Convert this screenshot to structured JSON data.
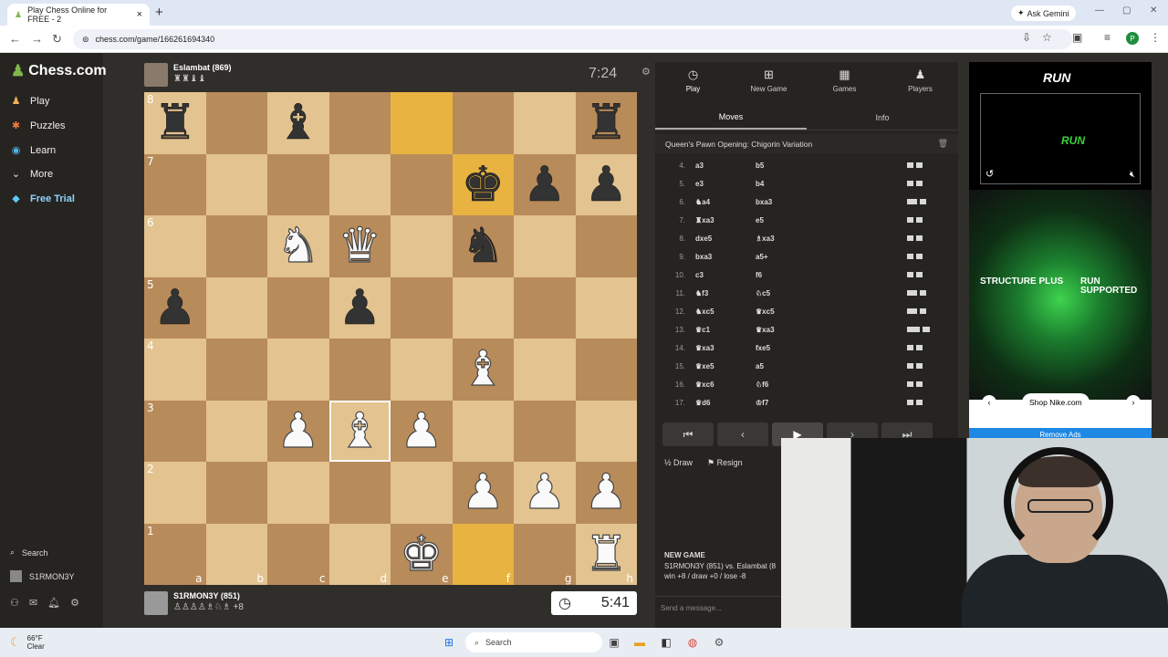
{
  "browser": {
    "tab_title": "Play Chess Online for FREE - 2",
    "ask_button": "Ask Gemini",
    "url": "chess.com/game/166261694340",
    "profile_initial": "P"
  },
  "sidebar": {
    "logo": "Chess.com",
    "items": [
      {
        "label": "Play",
        "icon": "chess-pawn-icon"
      },
      {
        "label": "Puzzles",
        "icon": "puzzle-icon"
      },
      {
        "label": "Learn",
        "icon": "learn-icon"
      },
      {
        "label": "More",
        "icon": "chevron-down-icon"
      },
      {
        "label": "Free Trial",
        "icon": "diamond-icon"
      }
    ],
    "search": "Search",
    "username": "S1RMON3Y"
  },
  "top_player": {
    "name": "Eslambat (869)",
    "captured": "♜♜♝♝",
    "clock": "7:24"
  },
  "bottom_player": {
    "name": "S1RMON3Y (851)",
    "captured": "♙♙♙♙♗♘♗ +8",
    "clock": "5:41"
  },
  "board": {
    "files": [
      "a",
      "b",
      "c",
      "d",
      "e",
      "f",
      "g",
      "h"
    ],
    "ranks": [
      "8",
      "7",
      "6",
      "5",
      "4",
      "3",
      "2",
      "1"
    ],
    "highlighted": [
      "e8",
      "f7",
      "f1"
    ],
    "selected": "d3",
    "rows": [
      [
        "bR",
        "",
        "bB",
        "",
        "",
        "",
        "",
        "bR"
      ],
      [
        "",
        "",
        "",
        "",
        "",
        "bK",
        "bP",
        "bP"
      ],
      [
        "",
        "",
        "wN",
        "wQ",
        "",
        "bN",
        "",
        ""
      ],
      [
        "bP",
        "",
        "",
        "bP",
        "",
        "",
        "",
        ""
      ],
      [
        "",
        "",
        "",
        "",
        "",
        "wB",
        "",
        ""
      ],
      [
        "",
        "",
        "wP",
        "wB",
        "wP",
        "",
        "",
        ""
      ],
      [
        "",
        "",
        "",
        "",
        "",
        "wP",
        "wP",
        "wP"
      ],
      [
        "",
        "",
        "",
        "",
        "wK",
        "",
        "",
        "wR"
      ]
    ]
  },
  "panel": {
    "tabs": [
      {
        "label": "Play",
        "icon": "clock-icon"
      },
      {
        "label": "New Game",
        "icon": "plus-icon"
      },
      {
        "label": "Games",
        "icon": "board-icon"
      },
      {
        "label": "Players",
        "icon": "players-icon"
      }
    ],
    "subtabs": [
      "Moves",
      "Info"
    ],
    "opening": "Queen's Pawn Opening: Chigorin Variation",
    "moves": [
      {
        "n": "4.",
        "w": "a3",
        "b": "b5",
        "wb": [
          0.2,
          0.7
        ],
        "bb": [
          0.2,
          0.7
        ]
      },
      {
        "n": "5.",
        "w": "e3",
        "b": "b4",
        "wb": [
          0.2,
          0.7
        ],
        "bb": [
          0.2,
          0.6
        ]
      },
      {
        "n": "6.",
        "w": "♞a4",
        "b": "bxa3",
        "wb": [
          0.3,
          0.7
        ],
        "bb": [
          0.2,
          0.6
        ]
      },
      {
        "n": "7.",
        "w": "♜xa3",
        "b": "e5",
        "wb": [
          0.2,
          0.6
        ],
        "bb": [
          0.2,
          0.6
        ]
      },
      {
        "n": "8.",
        "w": "dxe5",
        "b": "♗xa3",
        "wb": [
          0.2,
          0.5
        ],
        "bb": [
          0.2,
          0.6
        ]
      },
      {
        "n": "9.",
        "w": "bxa3",
        "b": "a5+",
        "wb": [
          0.2,
          0.6
        ],
        "bb": [
          0.2,
          0.5
        ]
      },
      {
        "n": "10.",
        "w": "c3",
        "b": "f6",
        "wb": [
          0.2,
          0.6
        ],
        "bb": [
          0.2,
          0.5
        ]
      },
      {
        "n": "11.",
        "w": "♞f3",
        "b": "♘c5",
        "wb": [
          0.3,
          0.7
        ],
        "bb": [
          0.2,
          0.6
        ]
      },
      {
        "n": "12.",
        "w": "♞xc5",
        "b": "♛xc5",
        "wb": [
          0.3,
          0.7
        ],
        "bb": [
          0.2,
          0.6
        ]
      },
      {
        "n": "13.",
        "w": "♛c1",
        "b": "♛xa3",
        "wb": [
          0.4,
          0.8
        ],
        "bb": [
          0.2,
          0.6
        ]
      },
      {
        "n": "14.",
        "w": "♛xa3",
        "b": "fxe5",
        "wb": [
          0.2,
          0.6
        ],
        "bb": [
          0.2,
          0.5
        ]
      },
      {
        "n": "15.",
        "w": "♛xe5",
        "b": "a5",
        "wb": [
          0.2,
          0.6
        ],
        "bb": [
          0.2,
          0.5
        ]
      },
      {
        "n": "16.",
        "w": "♛xc6",
        "b": "♘f6",
        "wb": [
          0.2,
          0.6
        ],
        "bb": [
          0.2,
          0.6
        ]
      },
      {
        "n": "17.",
        "w": "♛d6",
        "b": "♔f7",
        "wb": [
          0.2,
          0.6
        ],
        "bb": [
          0.2,
          0.5
        ]
      }
    ],
    "nav": [
      "⏮",
      "‹",
      "▶",
      "›",
      "⏭"
    ],
    "draw": "Draw",
    "resign": "Resign",
    "newgame_title": "NEW GAME",
    "newgame_line1": "S1RMON3Y (851) vs. Eslambat (8",
    "newgame_line2": "win +8 / draw +0 / lose -8",
    "chat_placeholder": "Send a message..."
  },
  "ad": {
    "brand": "RUN",
    "structure": "STRUCTURE PLUS",
    "supported": "RUN SUPPORTED",
    "cta": "Shop Nike.com",
    "remove": "Remove Ads"
  },
  "taskbar": {
    "temp": "66°F",
    "weather": "Clear",
    "search": "Search"
  }
}
